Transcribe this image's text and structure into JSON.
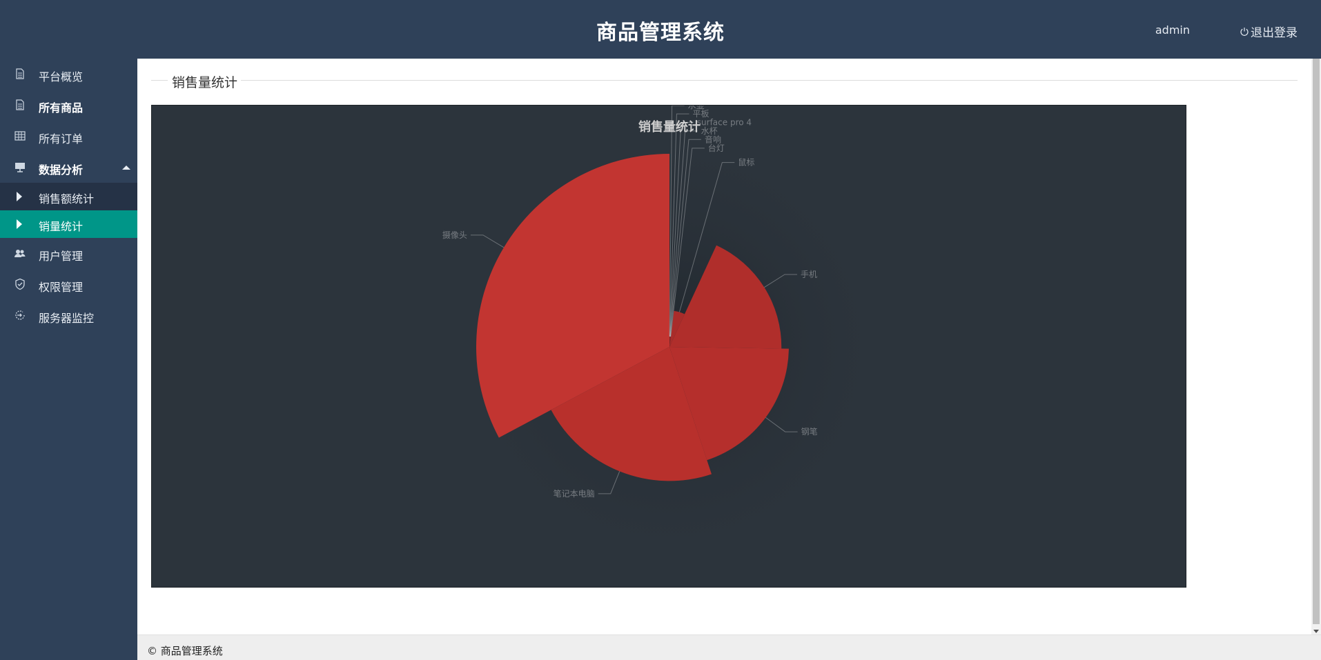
{
  "header": {
    "title": "商品管理系统",
    "user": "admin",
    "logout_label": "退出登录"
  },
  "sidebar": {
    "items": [
      {
        "label": "平台概览",
        "icon": "document-icon"
      },
      {
        "label": "所有商品",
        "icon": "document-icon"
      },
      {
        "label": "所有订单",
        "icon": "grid-icon"
      },
      {
        "label": "数据分析",
        "icon": "presentation-icon",
        "expanded": true
      },
      {
        "label": "用户管理",
        "icon": "users-icon"
      },
      {
        "label": "权限管理",
        "icon": "shield-icon"
      },
      {
        "label": "服务器监控",
        "icon": "monitor-icon"
      }
    ],
    "sub_items": [
      {
        "label": "销售额统计",
        "active": false
      },
      {
        "label": "销量统计",
        "active": true
      }
    ]
  },
  "main": {
    "section_title": "销售量统计"
  },
  "footer": {
    "text": "© 商品管理系统"
  },
  "colors": {
    "header_bg": "#2f4159",
    "sidebar_bg": "#2f4159",
    "active_bg": "#009688",
    "chart_bg": "#2c343c",
    "slice": "#c23531"
  },
  "chart_data": {
    "type": "pie",
    "rose_type": "radius",
    "title": "销售量统计",
    "categories": [
      "摄像头",
      "笔记本电脑",
      "钢笔",
      "手机",
      "鼠标",
      "台灯",
      "音响",
      "水杯",
      "surface pro 4",
      "平板",
      "水壶"
    ],
    "values": [
      100,
      68,
      60,
      56,
      15,
      1,
      1,
      1,
      1,
      1,
      1
    ],
    "label_side": [
      "left",
      "left",
      "right",
      "right",
      "right",
      "right",
      "right",
      "right",
      "right",
      "right",
      "right"
    ]
  }
}
